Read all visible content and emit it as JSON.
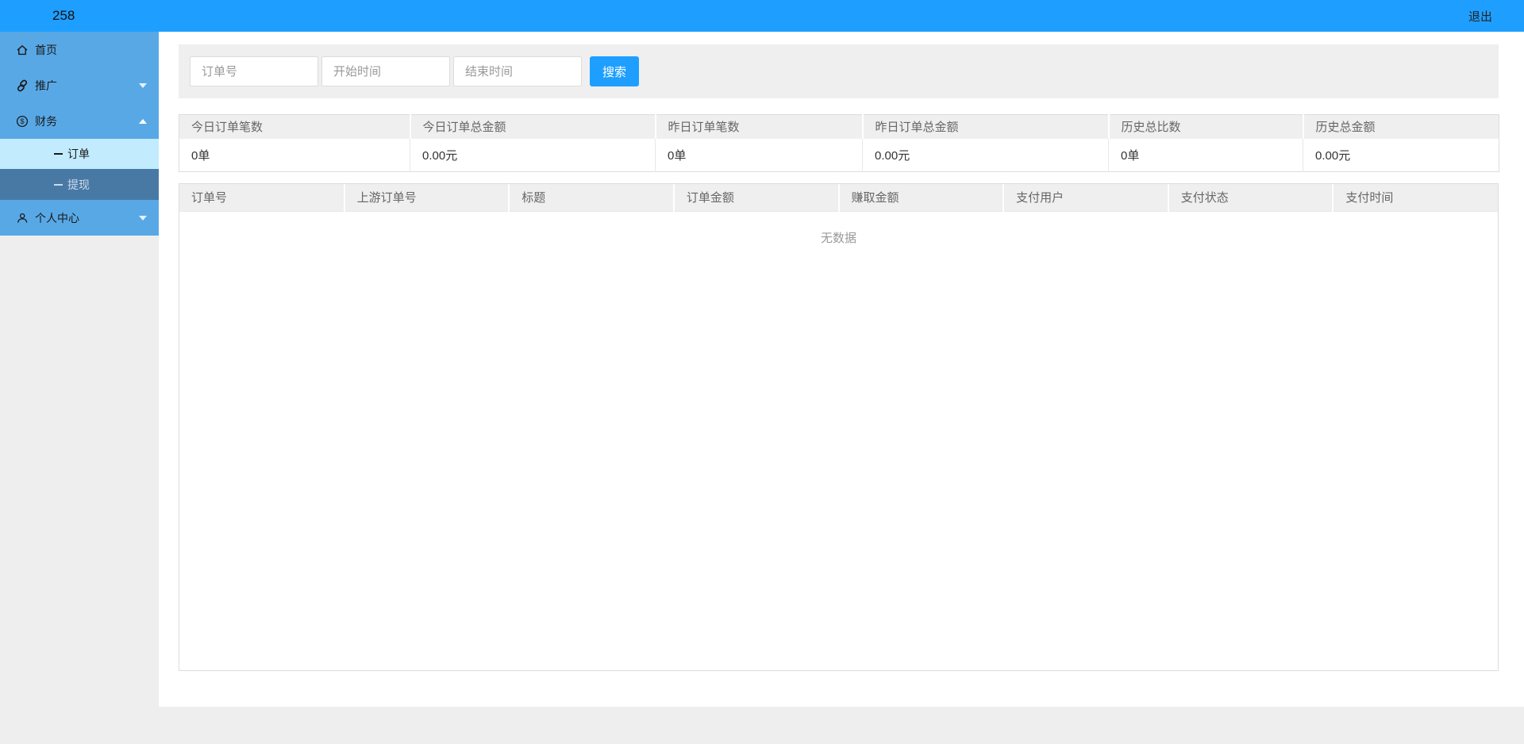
{
  "topbar": {
    "brand": "258",
    "logout_label": "退出"
  },
  "colors": {
    "accent_blue": "#1e9fff",
    "sidebar_blue": "#58a8e6",
    "active_subitem_bg": "#c2ebfd",
    "withdraw_subitem_bg": "#4879a5",
    "panel_gray": "#efefef",
    "page_gray": "#eeeeee",
    "border_gray": "#dddddd"
  },
  "sidebar": {
    "items": [
      {
        "label": "首页",
        "icon": "home-icon"
      },
      {
        "label": "推广",
        "icon": "link-icon",
        "arrow": "down"
      },
      {
        "label": "财务",
        "icon": "finance-icon",
        "arrow": "up",
        "expanded": true
      },
      {
        "label": "订单",
        "type": "sub",
        "active": true
      },
      {
        "label": "提现",
        "type": "sub",
        "active": false
      },
      {
        "label": "个人中心",
        "icon": "user-icon",
        "arrow": "down"
      }
    ]
  },
  "search": {
    "order_no_placeholder": "订单号",
    "start_time_placeholder": "开始时间",
    "end_time_placeholder": "结束时间",
    "button_label": "搜索"
  },
  "stats": {
    "columns": [
      {
        "header": "今日订单笔数",
        "value": "0单"
      },
      {
        "header": "今日订单总金额",
        "value": "0.00元"
      },
      {
        "header": "昨日订单笔数",
        "value": "0单"
      },
      {
        "header": "昨日订单总金额",
        "value": "0.00元"
      },
      {
        "header": "历史总比数",
        "value": "0单"
      },
      {
        "header": "历史总金额",
        "value": "0.00元"
      }
    ]
  },
  "orders_table": {
    "headers": [
      "订单号",
      "上游订单号",
      "标题",
      "订单金额",
      "赚取金额",
      "支付用户",
      "支付状态",
      "支付时间"
    ],
    "empty_text": "无数据"
  }
}
